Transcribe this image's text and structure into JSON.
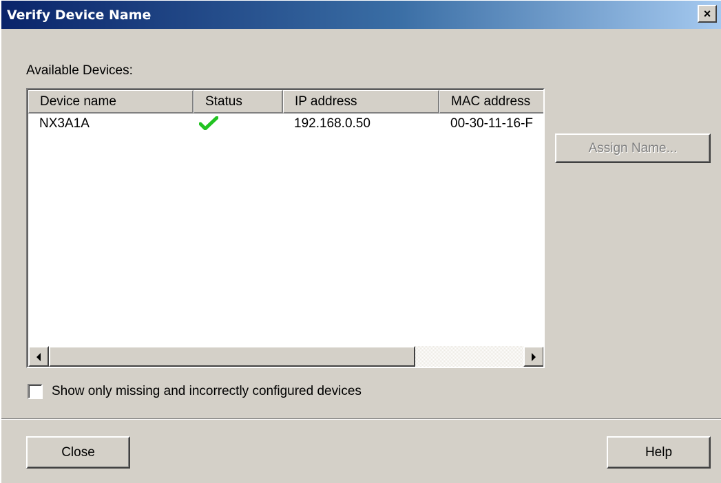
{
  "window": {
    "title": "Verify Device Name",
    "close_glyph": "×"
  },
  "available_label": "Available Devices:",
  "table": {
    "columns": [
      "Device name",
      "Status",
      "IP address",
      "MAC address"
    ],
    "rows": [
      {
        "device_name": "NX3A1A",
        "status": "ok",
        "status_icon": "checkmark-icon",
        "ip_address": "192.168.0.50",
        "mac_address": "00-30-11-16-F"
      }
    ],
    "status_color": "#22c322"
  },
  "buttons": {
    "assign_name": "Assign Name...",
    "close": "Close",
    "help": "Help"
  },
  "checkbox": {
    "label": "Show only missing and incorrectly configured devices",
    "checked": false
  },
  "colors": {
    "title_gradient_start": "#0a246a",
    "title_gradient_end": "#a6caf0",
    "dialog_bg": "#d4d0c8"
  }
}
